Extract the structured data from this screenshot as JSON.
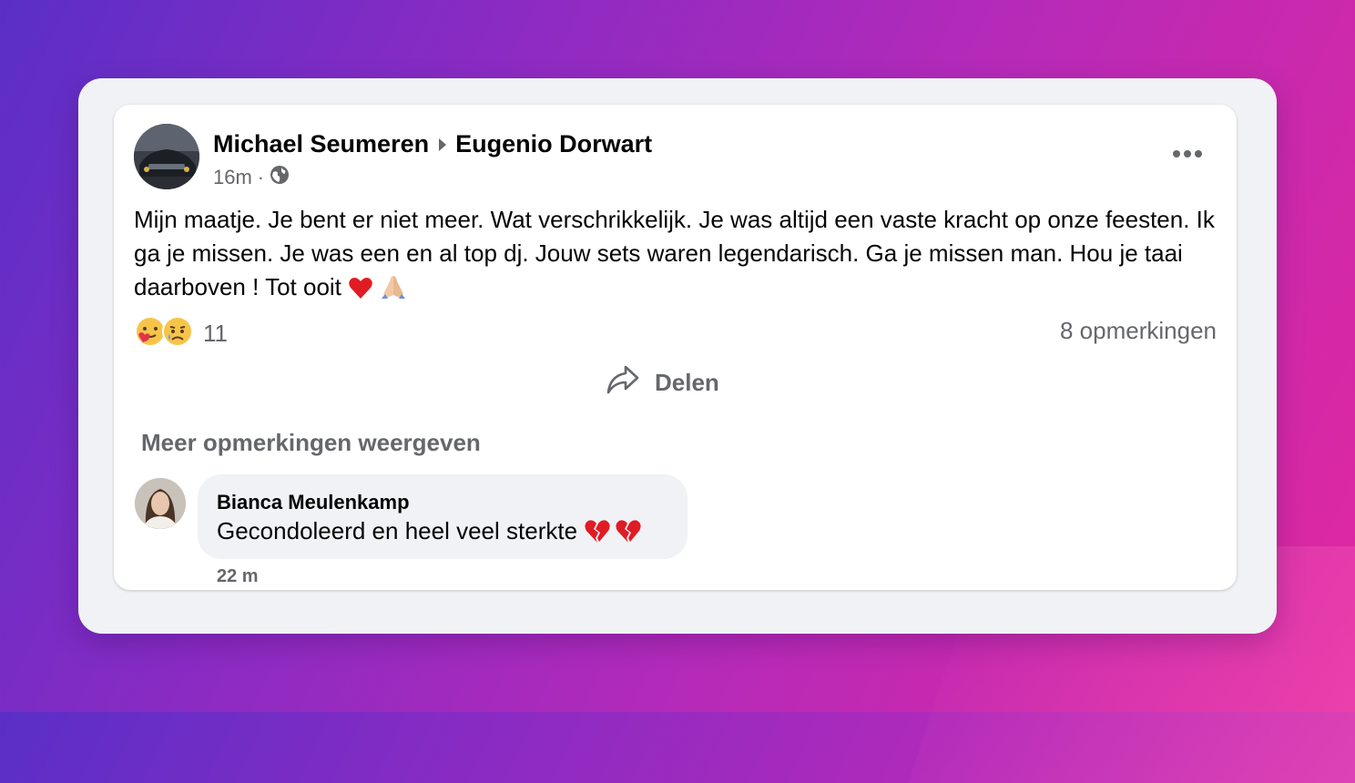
{
  "post": {
    "author": "Michael Seumeren",
    "target": "Eugenio Dorwart",
    "time": "16m",
    "separator": "·",
    "privacy_icon": "globe-icon",
    "text": "Mijn maatje. Je bent er niet meer. Wat verschrikkelijk. Je was altijd een vaste kracht op onze feesten. Ik ga je missen. Je was een en al top dj. Jouw sets waren legendarisch. Ga je missen man. Hou je taai daarboven ! Tot ooit",
    "text_emojis": [
      "red-heart-emoji",
      "folded-hands-emoji"
    ],
    "reactions": {
      "icons": [
        "care-emoji",
        "sad-emoji"
      ],
      "count": "11"
    },
    "comments_count": "8 opmerkingen",
    "share_label": "Delen",
    "more_menu_icon": "more-dots-icon"
  },
  "comments": {
    "more_label": "Meer opmerkingen weergeven",
    "items": [
      {
        "author": "Bianca Meulenkamp",
        "text": "Gecondoleerd en heel veel sterkte",
        "emojis": [
          "broken-heart-emoji",
          "broken-heart-emoji"
        ],
        "time": "22 m"
      }
    ]
  },
  "colors": {
    "card_bg": "#ffffff",
    "frame_bg": "#f0f2f5",
    "secondary_text": "#65676b",
    "primary_text": "#050505",
    "background_gradient": [
      "#5a2fc7",
      "#e2289f"
    ]
  }
}
